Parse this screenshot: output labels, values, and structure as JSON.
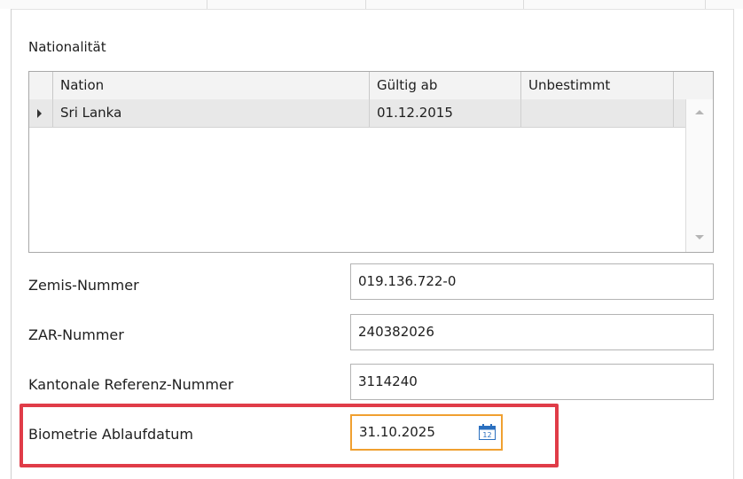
{
  "nationality": {
    "label": "Nationalität",
    "columns": [
      "Nation",
      "Gültig ab",
      "Unbestimmt"
    ],
    "rows": [
      {
        "nation": "Sri Lanka",
        "valid_from": "01.12.2015",
        "undetermined": ""
      }
    ]
  },
  "fields": {
    "zemis": {
      "label": "Zemis-Nummer",
      "value": "019.136.722-0"
    },
    "zar": {
      "label": "ZAR-Nummer",
      "value": "240382026"
    },
    "kanton": {
      "label": "Kantonale Referenz-Nummer",
      "value": "3114240"
    },
    "biometrie": {
      "label": "Biometrie Ablaufdatum",
      "value": "31.10.2025"
    }
  },
  "icons": {
    "calendar": "calendar-icon",
    "row_pointer": "row-pointer-icon"
  },
  "colors": {
    "highlight": "#e03c48",
    "focus_border": "#f0a030",
    "calendar_blue": "#2a6fbf"
  }
}
